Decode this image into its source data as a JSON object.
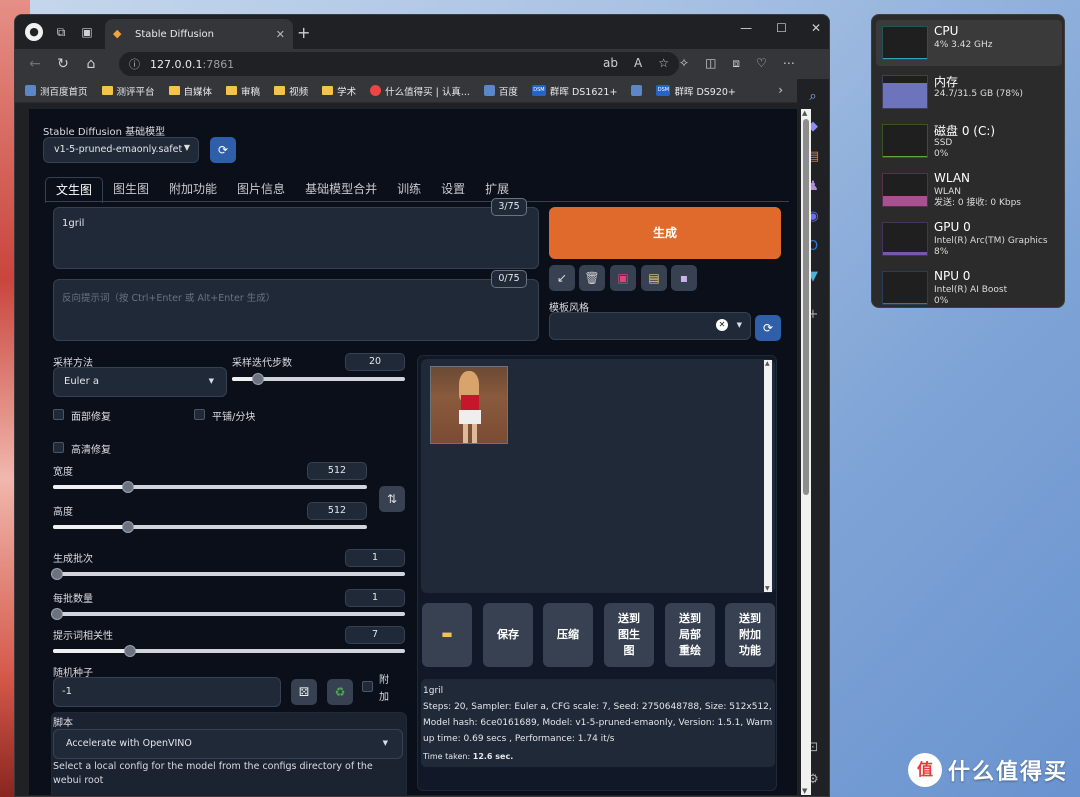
{
  "browser": {
    "tab_title": "Stable Diffusion",
    "url_host": "127.0.0.1",
    "url_port": ":7861",
    "bookmarks": [
      {
        "label": "测百度首页",
        "kind": "site"
      },
      {
        "label": "测评平台",
        "kind": "folder"
      },
      {
        "label": "自媒体",
        "kind": "folder"
      },
      {
        "label": "审稿",
        "kind": "folder"
      },
      {
        "label": "视频",
        "kind": "folder"
      },
      {
        "label": "学术",
        "kind": "folder"
      },
      {
        "label": "什么值得买 | 认真...",
        "kind": "site-red"
      },
      {
        "label": "百度",
        "kind": "site"
      },
      {
        "label": "群晖 DS1621+",
        "kind": "dsm"
      },
      {
        "label": "",
        "kind": "site"
      },
      {
        "label": "群晖 DS920+",
        "kind": "dsm"
      }
    ]
  },
  "sd": {
    "model_label": "Stable Diffusion 基础模型",
    "model_value": "v1-5-pruned-emaonly.safet",
    "tabs": [
      "文生图",
      "图生图",
      "附加功能",
      "图片信息",
      "基础模型合并",
      "训练",
      "设置",
      "扩展"
    ],
    "prompt_text": "1gril",
    "prompt_counter": "3/75",
    "neg_placeholder": "反向提示词（按 Ctrl+Enter 或 Alt+Enter 生成）",
    "neg_counter": "0/75",
    "generate_label": "生成",
    "style_label": "模板风格",
    "sampler_label": "采样方法",
    "sampler_value": "Euler a",
    "steps_label": "采样迭代步数",
    "steps_value": "20",
    "face_fix": "面部修复",
    "tiling": "平铺/分块",
    "hires": "高清修复",
    "width_label": "宽度",
    "width_value": "512",
    "height_label": "高度",
    "height_value": "512",
    "batch_count_label": "生成批次",
    "batch_count_value": "1",
    "batch_size_label": "每批数量",
    "batch_size_value": "1",
    "cfg_label": "提示词相关性",
    "cfg_value": "7",
    "seed_label": "随机种子",
    "seed_value": "-1",
    "extra_label_1": "附",
    "extra_label_2": "加",
    "script_label": "脚本",
    "script_value": "Accelerate with OpenVINO",
    "script_hint": "Select a local config for the model from the configs directory of the webui root",
    "actions": [
      "保存",
      "压缩",
      "送到\n图生\n图",
      "送到\n局部\n重绘",
      "送到\n附加\n功能"
    ],
    "info_prompt": "1gril",
    "info_params": "Steps: 20, Sampler: Euler a, CFG scale: 7, Seed: 2750648788, Size: 512x512, Model hash: 6ce0161689, Model: v1-5-pruned-emaonly, Version: 1.5.1, Warm up time: 0.69 secs , Performance: 1.74 it/s",
    "time_taken_label": "Time taken:",
    "time_taken_value": "12.6 sec."
  },
  "taskmgr": [
    {
      "name": "CPU",
      "sub1": "4%  3.42 GHz",
      "sub2": "",
      "sub3": "",
      "color": "#38b6d6",
      "level": 0.04
    },
    {
      "name": "内存",
      "sub1": "24.7/31.5 GB (78%)",
      "sub2": "",
      "sub3": "",
      "color": "#7b84d8",
      "level": 0.78
    },
    {
      "name": "磁盘 0 (C:)",
      "sub1": "SSD",
      "sub2": "0%",
      "sub3": "",
      "color": "#6cbf3c",
      "level": 0.0
    },
    {
      "name": "WLAN",
      "sub1": "WLAN",
      "sub2": "发送: 0 接收: 0 Kbps",
      "sub3": "",
      "color": "#c05aa4",
      "level": 0.3
    },
    {
      "name": "GPU 0",
      "sub1": "Intel(R) Arc(TM) Graphics",
      "sub2": "8%",
      "sub3": "",
      "color": "#8a62c9",
      "level": 0.08
    },
    {
      "name": "NPU 0",
      "sub1": "Intel(R) AI Boost",
      "sub2": "0%",
      "sub3": "",
      "color": "#3a82c8",
      "level": 0.0
    }
  ],
  "watermark": "什么值得买"
}
